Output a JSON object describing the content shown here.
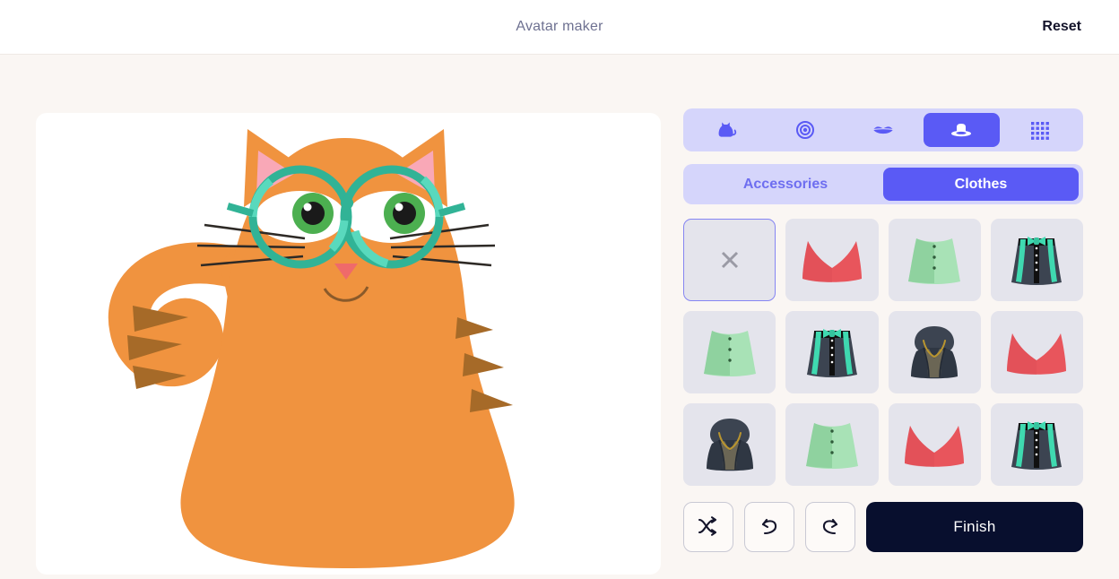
{
  "header": {
    "title": "Avatar maker",
    "reset_label": "Reset",
    "title_color": "#6e7191",
    "reset_color": "#14142b"
  },
  "theme": {
    "page_bg": "#faf6f3",
    "canvas_bg": "#ffffff",
    "accent": "#5a5af5",
    "accent_soft": "#d5d5fb",
    "tile_bg": "#e4e4ec",
    "finish_bg": "#080f2e"
  },
  "avatar": {
    "name": "cat-avatar",
    "fur_color": "#f0933f",
    "stripe_color": "#a66a28",
    "ear_inner_color": "#f9a8b7",
    "nose_color": "#ef6a6a",
    "glasses_color": "#31b396",
    "glasses_accent": "#59d9bd",
    "eye_iris_color": "#4caf50",
    "eye_white_color": "#ffffff",
    "pupil_color": "#1a1a1a",
    "whisker_color": "#2e2a26"
  },
  "tabs": [
    {
      "id": "body",
      "icon": "cat-icon",
      "label": "Body",
      "selected": false
    },
    {
      "id": "eyes",
      "icon": "eye-icon",
      "label": "Eyes",
      "selected": false
    },
    {
      "id": "mouth",
      "icon": "lips-icon",
      "label": "Mouth",
      "selected": false
    },
    {
      "id": "hat",
      "icon": "hat-icon",
      "label": "Hat",
      "selected": true
    },
    {
      "id": "more",
      "icon": "grid-dots-icon",
      "label": "More",
      "selected": false
    }
  ],
  "subtabs": [
    {
      "id": "accessories",
      "label": "Accessories",
      "selected": false
    },
    {
      "id": "clothes",
      "label": "Clothes",
      "selected": true
    }
  ],
  "items": [
    {
      "id": "none",
      "type": "none",
      "selected": true,
      "label": "None"
    },
    {
      "id": "red-top-1",
      "type": "red-top",
      "selected": false,
      "label": "Red top"
    },
    {
      "id": "green-skirt-1",
      "type": "green-skirt",
      "selected": false,
      "label": "Green skirt"
    },
    {
      "id": "dark-skirt-1",
      "type": "dark-skirt",
      "selected": false,
      "label": "Dark skirt with bow"
    },
    {
      "id": "green-skirt-2",
      "type": "green-skirt",
      "selected": false,
      "label": "Green skirt"
    },
    {
      "id": "dark-skirt-2",
      "type": "dark-skirt",
      "selected": false,
      "label": "Dark skirt with bow"
    },
    {
      "id": "hoodie-1",
      "type": "hoodie",
      "selected": false,
      "label": "Dark hoodie"
    },
    {
      "id": "red-top-2",
      "type": "red-top",
      "selected": false,
      "label": "Red top"
    },
    {
      "id": "hoodie-2",
      "type": "hoodie",
      "selected": false,
      "label": "Dark hoodie"
    },
    {
      "id": "green-skirt-3",
      "type": "green-skirt",
      "selected": false,
      "label": "Green skirt"
    },
    {
      "id": "red-top-3",
      "type": "red-top",
      "selected": false,
      "label": "Red top"
    },
    {
      "id": "dark-skirt-3",
      "type": "dark-skirt",
      "selected": false,
      "label": "Dark skirt with bow"
    }
  ],
  "item_colors": {
    "red": "#e8555c",
    "red_dark": "#d94a52",
    "green": "#8fd6a0",
    "green_light": "#a8e2b6",
    "green_dark": "#7ac48d",
    "navy": "#3c4451",
    "navy_dark": "#2f3743",
    "teal": "#3fd9b0",
    "black": "#101010",
    "gold": "#b9952f",
    "olive": "#6b6655"
  },
  "actions": {
    "shuffle_label": "Shuffle",
    "undo_label": "Undo",
    "redo_label": "Redo",
    "finish_label": "Finish"
  }
}
